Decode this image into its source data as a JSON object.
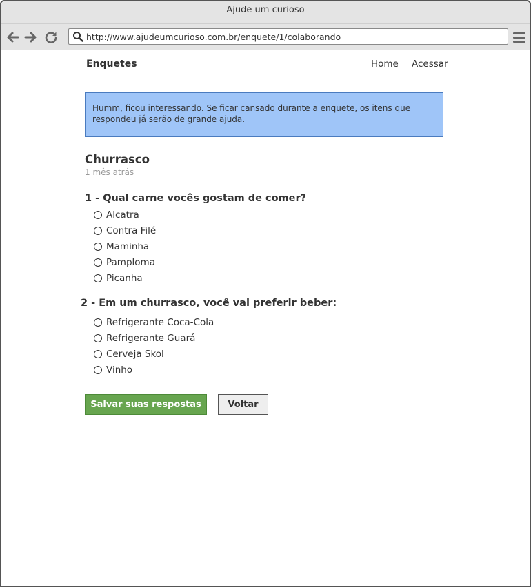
{
  "window": {
    "title": "Ajude um curioso"
  },
  "toolbar": {
    "back_icon": "arrow-left-icon",
    "forward_icon": "arrow-right-icon",
    "reload_icon": "reload-icon",
    "url": "http://www.ajudeumcurioso.com.br/enquete/1/colaborando",
    "menu_icon": "hamburger-menu-icon"
  },
  "navbar": {
    "brand": "Enquetes",
    "links": [
      "Home",
      "Acessar"
    ]
  },
  "alert": {
    "text": "Humm, ficou interessando. Se ficar cansado durante a enquete, os itens que respondeu já serão de grande ajuda.",
    "color": "#9fc5f8"
  },
  "poll": {
    "title": "Churrasco",
    "date": "1 mês atrás",
    "questions": [
      {
        "title": "1 - Qual carne vocês gostam de comer?",
        "options": [
          "Alcatra",
          "Contra Filé",
          "Maminha",
          "Pamploma",
          "Picanha"
        ]
      },
      {
        "title": "2 - Em um churrasco, você vai preferir beber:",
        "options": [
          "Refrigerante Coca-Cola",
          "Refrigerante Guará",
          "Cerveja Skol",
          "Vinho"
        ]
      }
    ]
  },
  "actions": {
    "save_label": "Salvar suas respostas",
    "back_label": "Voltar",
    "save_color": "#67a54f"
  }
}
